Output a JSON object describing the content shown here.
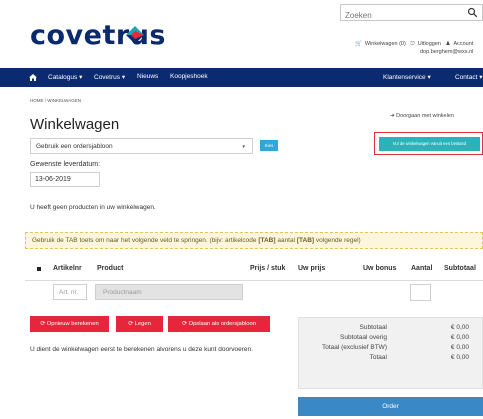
{
  "header": {
    "logo_text": "covetrus",
    "search_placeholder": "Zoeken",
    "links": {
      "cart": "Winkelwagen (0)",
      "logout": "Uitloggen",
      "account": "Account"
    },
    "user_email": "dop.berghem@wxs.nl"
  },
  "nav": {
    "items": [
      "Catalogus",
      "Covetrus",
      "Nieuws",
      "Koopjeshoek"
    ],
    "right_items": [
      "Klantenservice",
      "Contact"
    ]
  },
  "breadcrumb": "HOME / WINKELWAGEN",
  "continue_shopping": "Doorgaan met winkelen",
  "page_title": "Winkelwagen",
  "template_select": {
    "selected": "Gebruik een ordersjabloon"
  },
  "ok_button": "Kies",
  "fill_button": "Vul de winkelwagen vanuit een bestand",
  "delivery": {
    "label": "Gewenste leverdatum:",
    "value": "13-06-2019"
  },
  "empty_message": "U heeft geen producten in uw winkelwagen.",
  "tab_hint": {
    "prefix": "Gebruik de TAB toets om naar het volgende veld te springen. (bijv: artikelcode ",
    "tab1": "[TAB]",
    "middle": " aantal ",
    "tab2": "[TAB]",
    "suffix": " volgende regel)"
  },
  "table": {
    "headers": [
      "Artikelnr",
      "Product",
      "Prijs / stuk",
      "Uw prijs",
      "Uw bonus",
      "Aantal",
      "Subtotaal"
    ],
    "article_placeholder": "Art. nr.",
    "product_placeholder": "Productnaam"
  },
  "buttons": {
    "recalculate": "Opnieuw berekenen",
    "clear": "Legen",
    "save_template": "Opslaan als ordersjabloon"
  },
  "recalc_message": "U dient de winkelwagen eerst te berekenen alvorens u deze kunt doorvoeren.",
  "totals": {
    "rows": [
      {
        "label": "Subtotaal",
        "value": "€ 0,00"
      },
      {
        "label": "Subtotaal overig",
        "value": "€ 0,00"
      },
      {
        "label": "Totaal (exclusief BTW)",
        "value": "€ 0,00"
      },
      {
        "label": "Totaal",
        "value": "€ 0,00"
      }
    ]
  },
  "order_button": "Order",
  "colors": {
    "navy": "#0c2a70",
    "teal_button": "#2bb3b9",
    "red_button": "#e6263c",
    "order_button": "#3b88c7"
  }
}
